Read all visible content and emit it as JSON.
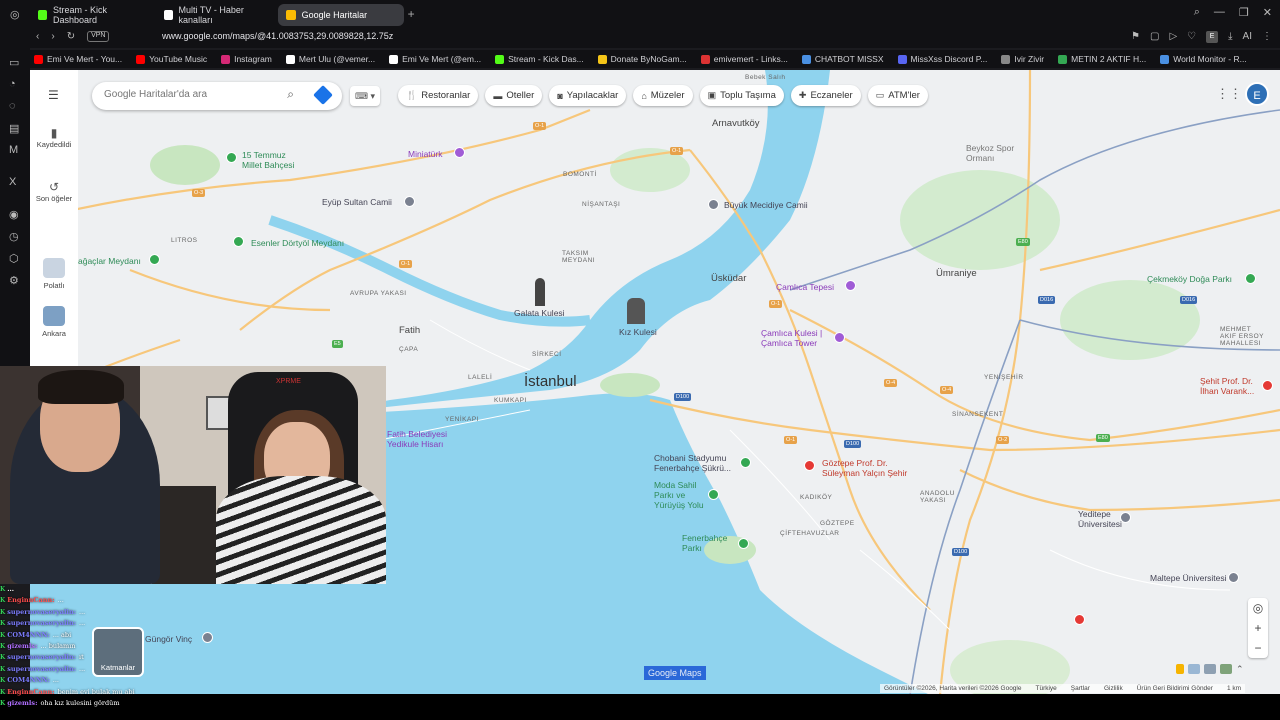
{
  "browser": {
    "tabs": [
      {
        "label": "Stream - Kick Dashboard",
        "color": "#53fc18",
        "active": false
      },
      {
        "label": "Multi TV - Haber kanalları",
        "color": "#ffffff",
        "active": false
      },
      {
        "label": "Google Haritalar",
        "color": "#fbbc04",
        "active": true
      }
    ],
    "url": "www.google.com/maps/@41.0083753,29.0089828,12.75z",
    "vpn_label": "VPN",
    "ai_label": "AI",
    "profile_letter": "E",
    "bookmarks": [
      {
        "label": "Emi Ve Mert - You...",
        "color": "#ff0000"
      },
      {
        "label": "YouTube Music",
        "color": "#ff0000"
      },
      {
        "label": "Instagram",
        "color": "#d62976"
      },
      {
        "label": "Mert Ulu (@vemer...",
        "color": "#ffffff"
      },
      {
        "label": "Emi Ve Mert (@em...",
        "color": "#ffffff"
      },
      {
        "label": "Stream - Kick Das...",
        "color": "#53fc18"
      },
      {
        "label": "Donate ByNoGam...",
        "color": "#f5c518"
      },
      {
        "label": "emivemert - Links...",
        "color": "#d33"
      },
      {
        "label": "CHATBOT MISSX",
        "color": "#4a90e2"
      },
      {
        "label": "MissXss Discord P...",
        "color": "#5865f2"
      },
      {
        "label": "Ivir Zivir",
        "color": "#888888"
      },
      {
        "label": "METIN 2 AKTIF H...",
        "color": "#34a853"
      },
      {
        "label": "World Monitor - R...",
        "color": "#4a90e2"
      }
    ]
  },
  "maps": {
    "search_placeholder": "Google Haritalar'da ara",
    "saved_label": "Kaydedildi",
    "recent_label": "Son öğeler",
    "recent_places": [
      {
        "label": "Polatlı"
      },
      {
        "label": "Ankara"
      }
    ],
    "chips": [
      {
        "label": "Restoranlar",
        "icon": "fork-icon"
      },
      {
        "label": "Oteller",
        "icon": "bed-icon"
      },
      {
        "label": "Yapılacaklar",
        "icon": "camera-icon"
      },
      {
        "label": "Müzeler",
        "icon": "museum-icon"
      },
      {
        "label": "Toplu Taşıma",
        "icon": "bus-icon"
      },
      {
        "label": "Eczaneler",
        "icon": "pharmacy-icon"
      },
      {
        "label": "ATM'ler",
        "icon": "atm-icon"
      }
    ],
    "layers_label": "Katmanlar",
    "google_maps_label": "Google Maps",
    "footer": [
      "Görüntüler ©2026, Harita verileri ©2026 Google",
      "Türkiye",
      "Şartlar",
      "Gizlilik",
      "Ürün Geri Bildirimi Gönder",
      "1 km"
    ],
    "labels": {
      "istanbul": "İstanbul",
      "arnavutkoy": "Arnavutköy",
      "uskudar": "Üsküdar",
      "umraniye": "Ümraniye",
      "fatih": "Fatih",
      "beykoz": "Beykoz Spor\nOrmanı",
      "bebek": "Bebek Salıh",
      "miniaturk": "Miniatürk",
      "temmuz": "15 Temmuz\nMillet Bahçesi",
      "eyup": "Eyüp Sultan Camii",
      "esenler": "Esenler Dörtyöl Meydanı",
      "agaclar": "ağaçlar Meydanı",
      "buyuk_mecidiye": "Büyük Mecidiye Camii",
      "galata": "Galata Kulesi",
      "kiz": "Kız Kulesi",
      "camlica_tepesi": "Çamlıca Tepesi",
      "camlica_kulesi": "Çamlıca Kulesi |\nÇamlıca Tower",
      "cekmekoy": "Çekmeköy Doğa Parkı",
      "mehmet": "MEHMET\nAKIF ERSOY\nMAHALLESI",
      "sehit": "Şehit Prof. Dr.\nİlhan Varank...",
      "fatih_bel": "Fatih Belediyesi\nYedikule Hisarı",
      "chobani": "Chobani Stadyumu\nFenerbahçe Şükrü...",
      "moda": "Moda Sahil\nParkı ve\nYürüyüş Yolu",
      "fenerbahce": "Fenerbahçe\nParkı",
      "goztepe_h": "Göztepe Prof. Dr.\nSüleyman Yalçın Şehir",
      "yeditepe": "Yeditepe\nÜniversitesi",
      "maltepe": "Maltepe Üniversitesi",
      "gungor": "Güngör Vinç",
      "bomonti": "BOMONTİ",
      "nisantasi": "NİŞANTAŞI",
      "taksim": "TAKSIM\nMEYDANI",
      "litros": "LITROS",
      "avrupa": "AVRUPA YAKASI",
      "capa": "ÇAPA",
      "laleli": "LALELİ",
      "kumkapi": "KUMKAPI",
      "yenikapi": "YENİKAPI",
      "sirkeci": "SİRKECİ",
      "kadikoy": "KADIKÖY",
      "goztepe": "GÖZTEPE",
      "ciftehavuzlar": "ÇİFTEHAVUZLAR",
      "anadolu": "ANADOLU\nYAKASI",
      "yenisehir": "YENİŞEHİR",
      "sinansekent": "SİNANSEKENT"
    }
  },
  "chat": [
    {
      "user": "...",
      "text": "",
      "color": "#ffffff"
    },
    {
      "user": "EnginnCann:",
      "text": "...",
      "color": "#ff4d4d"
    },
    {
      "user": "supernovaseryalin:",
      "text": "...",
      "color": "#7d7dff"
    },
    {
      "user": "supernovaseryalin:",
      "text": "...",
      "color": "#7d7dff"
    },
    {
      "user": "COM4NNN:",
      "text": "... abi",
      "color": "#7d7dff"
    },
    {
      "user": "gizemls:",
      "text": "... bulamın",
      "color": "#b06fff"
    },
    {
      "user": "supernovaseryalin:",
      "text": "ıt",
      "color": "#7d7dff"
    },
    {
      "user": "supernovaseryalin:",
      "text": "...",
      "color": "#7d7dff"
    },
    {
      "user": "COM4NNN:",
      "text": "...",
      "color": "#7d7dff"
    },
    {
      "user": "EnginnCann:",
      "text": "benim evi bulak mu abi",
      "color": "#ff4d4d"
    },
    {
      "user": "gizemls:",
      "text": "oha kız kulesini gördüm",
      "color": "#b06fff"
    }
  ],
  "cam_logo": "XPRME"
}
